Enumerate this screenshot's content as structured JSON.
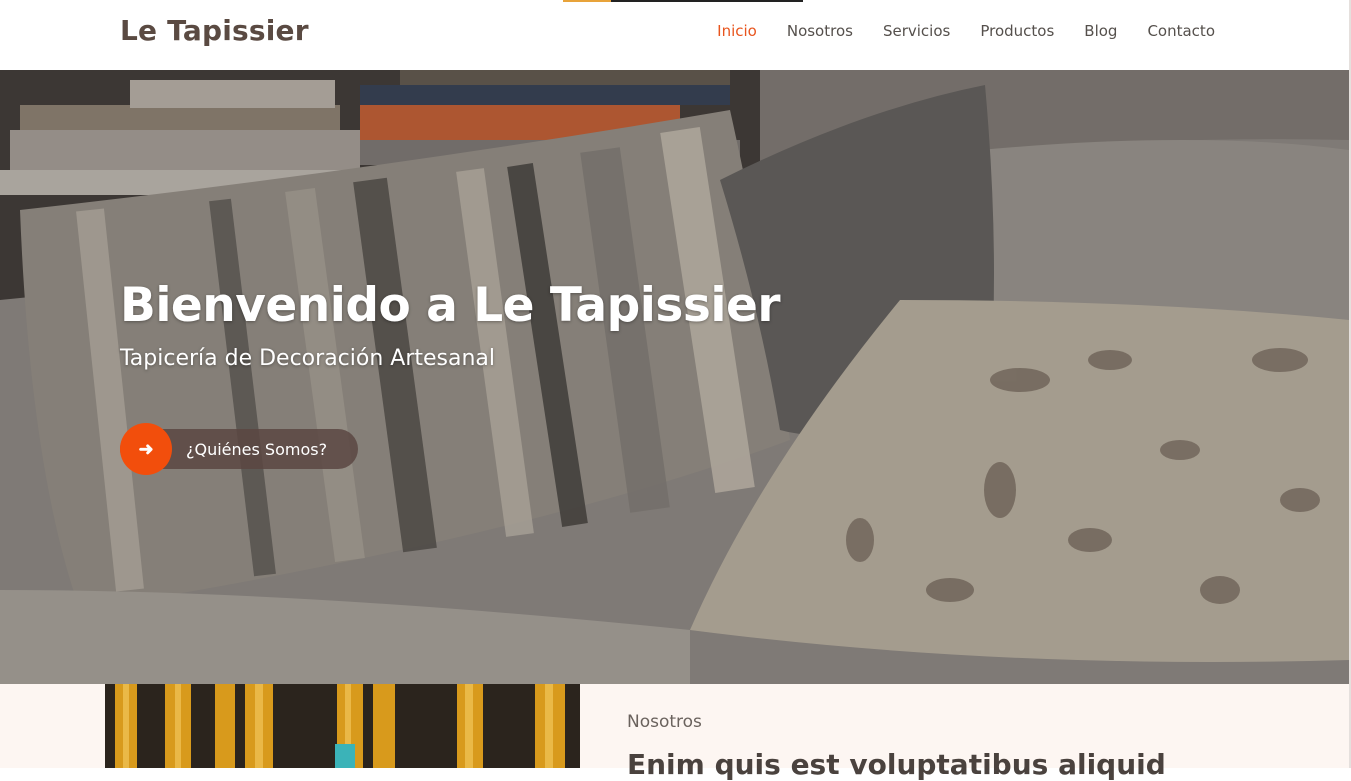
{
  "header": {
    "logo": "Le Tapissier",
    "nav": [
      {
        "label": "Inicio",
        "active": true
      },
      {
        "label": "Nosotros",
        "active": false
      },
      {
        "label": "Servicios",
        "active": false
      },
      {
        "label": "Productos",
        "active": false
      },
      {
        "label": "Blog",
        "active": false
      },
      {
        "label": "Contacto",
        "active": false
      }
    ]
  },
  "hero": {
    "title": "Bienvenido a Le Tapissier",
    "subtitle": "Tapicería de Decoración Artesanal",
    "cta_label": "¿Quiénes Somos?",
    "cta_icon": "arrow-right-icon"
  },
  "about": {
    "eyebrow": "Nosotros",
    "heading": "Enim quis est voluptatibus aliquid"
  },
  "colors": {
    "accent": "#f24e0c",
    "nav_active": "#e8551e",
    "logo": "#5a4a42",
    "section_bg": "#fdf6f2"
  }
}
